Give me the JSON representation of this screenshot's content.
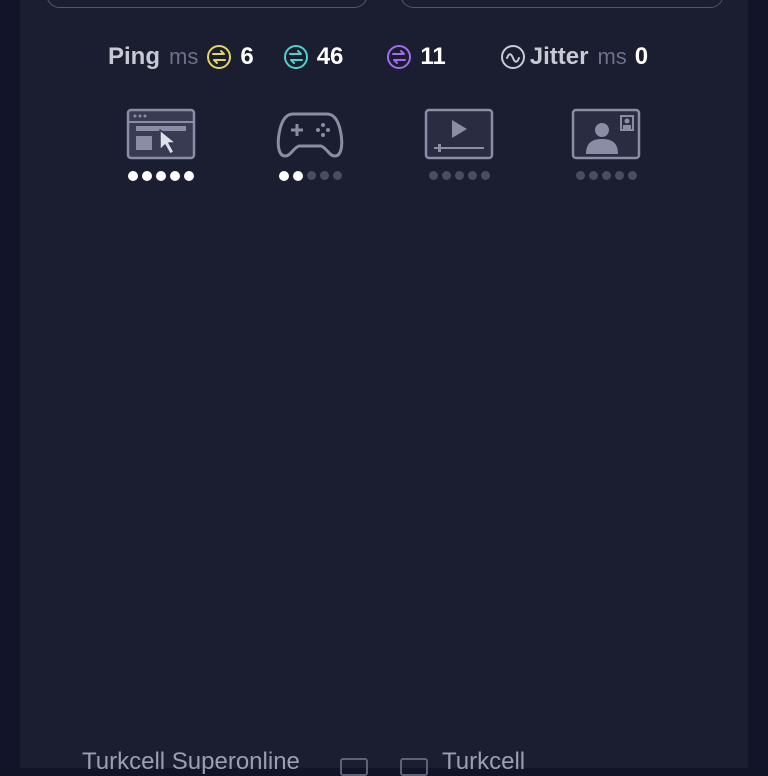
{
  "metrics": {
    "ping_label": "Ping",
    "ping_unit": "ms",
    "idle_ping": "6",
    "download_ping": "46",
    "upload_ping": "11",
    "jitter_label": "Jitter",
    "jitter_unit": "ms",
    "jitter_value": "0"
  },
  "colors": {
    "idle": "#e3d65c",
    "download": "#4fd1cf",
    "upload": "#a26bf0",
    "jitter": "#c7c9d4"
  },
  "activities": [
    {
      "name": "web-browsing",
      "icon": "browser-cursor-icon",
      "rating": 5,
      "max": 5
    },
    {
      "name": "gaming",
      "icon": "gamepad-icon",
      "rating": 2,
      "max": 5
    },
    {
      "name": "video-streaming",
      "icon": "video-player-icon",
      "rating": 0,
      "max": 5
    },
    {
      "name": "video-calls",
      "icon": "video-call-icon",
      "rating": 0,
      "max": 5
    }
  ],
  "connection": {
    "server_provider": "Turkcell Superonline",
    "client_provider": "Turkcell"
  }
}
